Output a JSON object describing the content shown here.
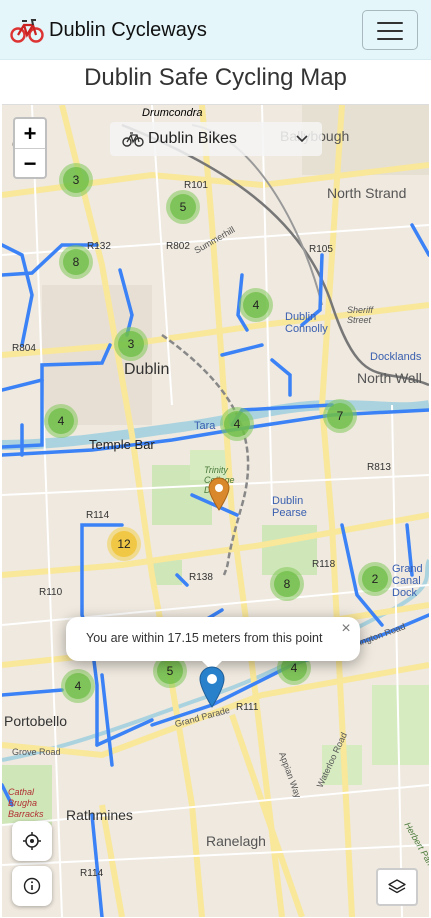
{
  "app": {
    "brand_title": "Dublin Cycleways"
  },
  "page": {
    "title": "Dublin Safe Cycling Map"
  },
  "map": {
    "zoom_in_label": "+",
    "zoom_out_label": "−",
    "layer_select": {
      "selected": "Dublin Bikes"
    },
    "clusters": [
      {
        "count": "3",
        "color": "green"
      },
      {
        "count": "5",
        "color": "green"
      },
      {
        "count": "8",
        "color": "green"
      },
      {
        "count": "4",
        "color": "green"
      },
      {
        "count": "3",
        "color": "green"
      },
      {
        "count": "4",
        "color": "green"
      },
      {
        "count": "4",
        "color": "green"
      },
      {
        "count": "7",
        "color": "green"
      },
      {
        "count": "12",
        "color": "yellow"
      },
      {
        "count": "8",
        "color": "green"
      },
      {
        "count": "2",
        "color": "green"
      },
      {
        "count": "5",
        "color": "green"
      },
      {
        "count": "4",
        "color": "green"
      },
      {
        "count": "4",
        "color": "green"
      }
    ],
    "popup": {
      "text": "You are within 17.15 meters from this point",
      "close_label": "×"
    },
    "place_labels": {
      "drumcondra": "Drumcondra",
      "ballybough": "Ballybough",
      "phibsborough": "ough",
      "north_strand": "North Strand",
      "dublin": "Dublin",
      "dublin_connolly": "Dublin Connolly",
      "docklands": "Docklands",
      "north_wall": "North Wall",
      "temple_bar": "Temple Bar",
      "tara": "Tara",
      "trinity": "Trinity College Dublin",
      "dublin_pearse": "Dublin Pearse",
      "grand_canal_dock": "Grand Canal Dock",
      "portobello": "Portobello",
      "rathmines": "Rathmines",
      "ranelagh": "Ranelagh",
      "cathal_brugha": "Cathal Brugha Barracks",
      "grand_parade": "Grand Parade",
      "grove_road": "Grove Road",
      "herbert_park": "Herbert Park",
      "appian_way": "Appian Way",
      "waterloo_road": "Waterloo Road",
      "haddington_road": "Haddington Road",
      "sheriff_street": "Sheriff Street",
      "summerhill": "Summerhill",
      "r101": "R101",
      "r132": "R132",
      "r802": "R802",
      "r105": "R105",
      "r804": "R804",
      "r813": "R813",
      "r114a": "R114",
      "r118": "R118",
      "r138": "R138",
      "r110": "R110",
      "r111": "R111",
      "r114b": "R114"
    },
    "colors": {
      "cycleway": "#3b82f6",
      "cluster": "#7bc35a",
      "cluster_large": "#f0c232",
      "marker_blue": "#2a81cb",
      "marker_orange": "#d9892b"
    }
  }
}
